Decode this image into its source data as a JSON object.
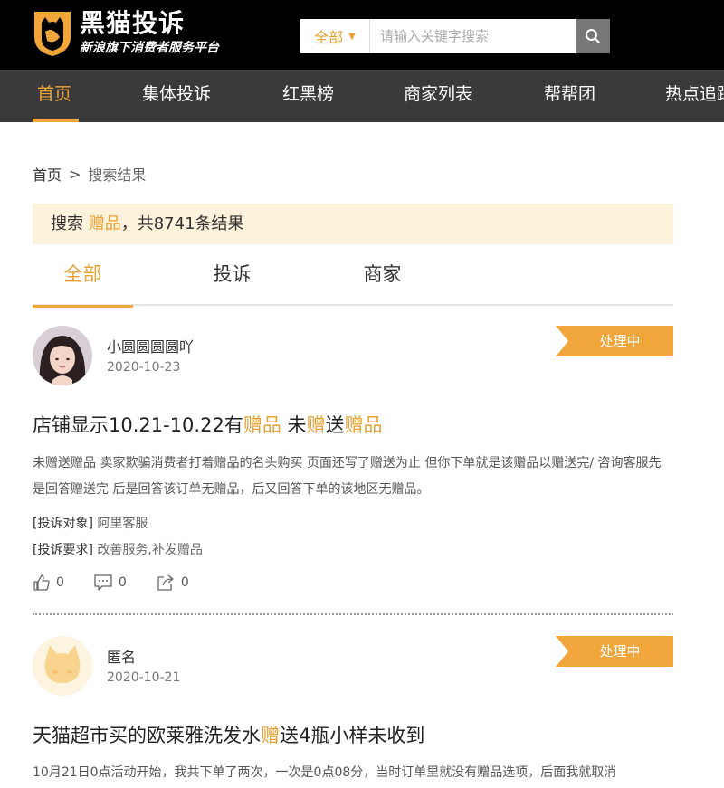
{
  "header": {
    "brand_name": "黑猫投诉",
    "brand_sub": "新浪旗下消费者服务平台",
    "search_scope": "全部",
    "search_placeholder": "请输入关键字搜索"
  },
  "nav": {
    "items": [
      {
        "label": "首页",
        "active": true
      },
      {
        "label": "集体投诉"
      },
      {
        "label": "红黑榜"
      },
      {
        "label": "商家列表"
      },
      {
        "label": "帮帮团"
      },
      {
        "label": "热点追踪"
      }
    ]
  },
  "breadcrumb": {
    "home": "首页",
    "separator": ">",
    "current": "搜索结果"
  },
  "result": {
    "prefix": "搜索 ",
    "keyword": "赠品",
    "suffix": "，共8741条结果"
  },
  "tabs": [
    {
      "label": "全部",
      "active": true
    },
    {
      "label": "投诉"
    },
    {
      "label": "商家"
    }
  ],
  "complaints": [
    {
      "user": "小圆圆圆圆吖",
      "date": "2020-10-23",
      "status": "处理中",
      "title_parts": [
        {
          "t": "店铺显示10.21-10.22有"
        },
        {
          "t": "赠品",
          "hl": true
        },
        {
          "t": " 未"
        },
        {
          "t": "赠",
          "hl": true
        },
        {
          "t": "送"
        },
        {
          "t": "赠品",
          "hl": true
        }
      ],
      "description": "未赠送赠品 卖家欺骗消费者打着赠品的名头购买 页面还写了赠送为止 但你下单就是该赠品以赠送完/ 咨询客服先是回答赠送完 后是回答该订单无赠品，后又回答下单的该地区无赠品。",
      "target_label": "[投诉对象]",
      "target": "阿里客服",
      "demand_label": "[投诉要求]",
      "demand": "改善服务,补发赠品",
      "likes": "0",
      "comments": "0",
      "shares": "0"
    },
    {
      "user": "匿名",
      "date": "2020-10-21",
      "status": "处理中",
      "title_parts": [
        {
          "t": "天猫超市买的欧莱雅洗发水"
        },
        {
          "t": "赠",
          "hl": true
        },
        {
          "t": "送4瓶小样未收到"
        }
      ],
      "description": "10月21日0点活动开始，我共下单了两次，一次是0点08分，当时订单里就没有赠品选项，后面我就取消"
    }
  ],
  "colors": {
    "accent": "#f0a63b",
    "nav_bg": "#3a3a3a",
    "header_bg": "#000000",
    "result_bg": "#fdf2dc"
  }
}
